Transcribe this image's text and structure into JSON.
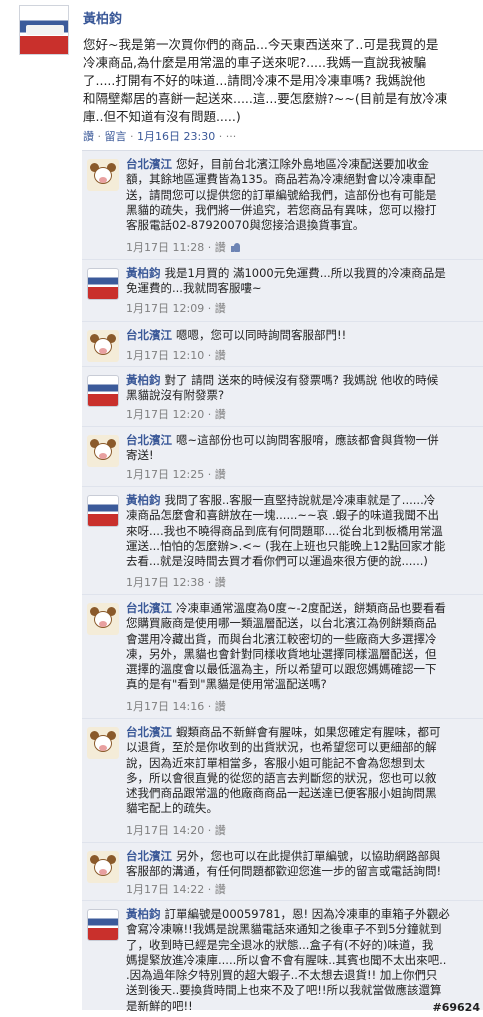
{
  "post": {
    "author": "黃柏鈞",
    "text": "您好~我是第一次買你們的商品...今天東西送來了..可是我買的是\n冷凍商品,為什麼是用常溫的車子送來呢?.....我媽一直說我被騙\n了.....打開有不好的味道...請問冷凍不是用冷凍車嗎? 我媽說他\n和隔壁鄰居的喜餅一起送來.....這...要怎麼辦?~~(目前是有放冷凍\n庫..但不知道有沒有問題.....)",
    "actions": {
      "like": "讚",
      "separator": " · ",
      "comment": "留言",
      "time": "1月16日 23:30",
      "more": "···"
    }
  },
  "comments": [
    {
      "author": "台北濱江",
      "avatar": "store-avatar",
      "text": "您好，目前台北濱江除外島地區冷凍配送要加收金\n額，其餘地區運費皆為135。商品若為冷凍絕對會以冷凍車配\n送，請問您可以提供您的訂單編號給我們，這部份也有可能是\n黑貓的疏失，我們將一併追究，若您商品有異味，您可以撥打\n客服電話02-87920070與您接洽退換貨事宜。",
      "time": "1月17日 11:28",
      "like": "讚"
    },
    {
      "author": "黃柏鈞",
      "avatar": "user-avatar",
      "text": "我是1月買的 滿1000元免運費...所以我買的冷凍商品是\n免運費的...我就問客服嘍~",
      "time": "1月17日 12:09",
      "like": "讚"
    },
    {
      "author": "台北濱江",
      "avatar": "store-avatar",
      "text": "嗯嗯，您可以同時詢問客服部門!!",
      "time": "1月17日 12:10",
      "like": "讚"
    },
    {
      "author": "黃柏鈞",
      "avatar": "user-avatar",
      "text": "對了 請問 送來的時候沒有發票嗎? 我媽說 他收的時候\n黑貓說沒有附發票?",
      "time": "1月17日 12:20",
      "like": "讚"
    },
    {
      "author": "台北濱江",
      "avatar": "store-avatar",
      "text": "嗯~這部份也可以詢問客服唷，應該都會與貨物一併\n寄送!",
      "time": "1月17日 12:25",
      "like": "讚"
    },
    {
      "author": "黃柏鈞",
      "avatar": "user-avatar",
      "text": "我問了客服..客服一直堅持說就是冷凍車就是了......冷\n凍商品怎麼會和喜餅放在一塊......~~哀 .蝦子的味道我聞不出\n來呀....我也不曉得商品到底有何問題耶....從台北到板橋用常溫\n運送...怕怕的怎麼辦>.<~ (我在上班也只能晚上12點回家才能\n去看...就是沒時間去買才看你們可以運過來很方便的說......)",
      "time": "1月17日 12:38",
      "like": "讚"
    },
    {
      "author": "台北濱江",
      "avatar": "store-avatar",
      "text": "冷凍車通常溫度為0度~-2度配送，餅類商品也要看看\n您購買廠商是使用哪一類溫層配送，以台北濱江為例餅類商品\n會選用冷藏出貨，而與台北濱江較密切的一些廠商大多選擇冷\n凍，另外，黑貓也會針對同樣收貨地址選擇同樣溫層配送，但\n選擇的溫度會以最低溫為主，所以希望可以跟您媽媽確認一下\n真的是有\"看到\"黑貓是使用常溫配送嗎?",
      "time": "1月17日 14:16",
      "like": "讚"
    },
    {
      "author": "台北濱江",
      "avatar": "store-avatar",
      "text": "蝦類商品不新鮮會有腥味，如果您確定有腥味，都可\n以退貨，至於是你收到的出貨狀況，也希望您可以更細部的解\n說，因為近來訂單相當多，客服小姐可能記不會為您想到太\n多，所以會很直覺的從您的語言去判斷您的狀況，您也可以敘\n述我們商品跟常溫的他廠商商品一起送達已便客服小姐詢問黑\n貓宅配上的疏失。",
      "time": "1月17日 14:20",
      "like": "讚"
    },
    {
      "author": "台北濱江",
      "avatar": "store-avatar",
      "text": "另外，您也可以在此提供訂單編號，以協助網路部與\n客服部的溝通，有任何問題都歡迎您進一步的留言或電話詢問!",
      "time": "1月17日 14:22",
      "like": "讚"
    },
    {
      "author": "黃柏鈞",
      "avatar": "user-avatar",
      "text": "訂單編號是00059781，恩! 因為冷凍車的車箱子外觀必\n會寫冷凍嘛!!我媽是說黑貓電話來通知之後車子不到5分鐘就到\n了，收到時已經是完全退冰的狀態...盒子有(不好的)味道，我\n媽提緊放進冷凍庫.....所以會不會有腥味..其賓也聞不太出來吧..\n.因為過年除夕特別買的超大蝦子..不太想去退貨!! 加上你們只\n送到後天..要換貨時間上也來不及了吧!!所以我就當做應該還算\n是新鮮的吧!!",
      "time": "",
      "like": ""
    }
  ],
  "watermark": "#69624"
}
